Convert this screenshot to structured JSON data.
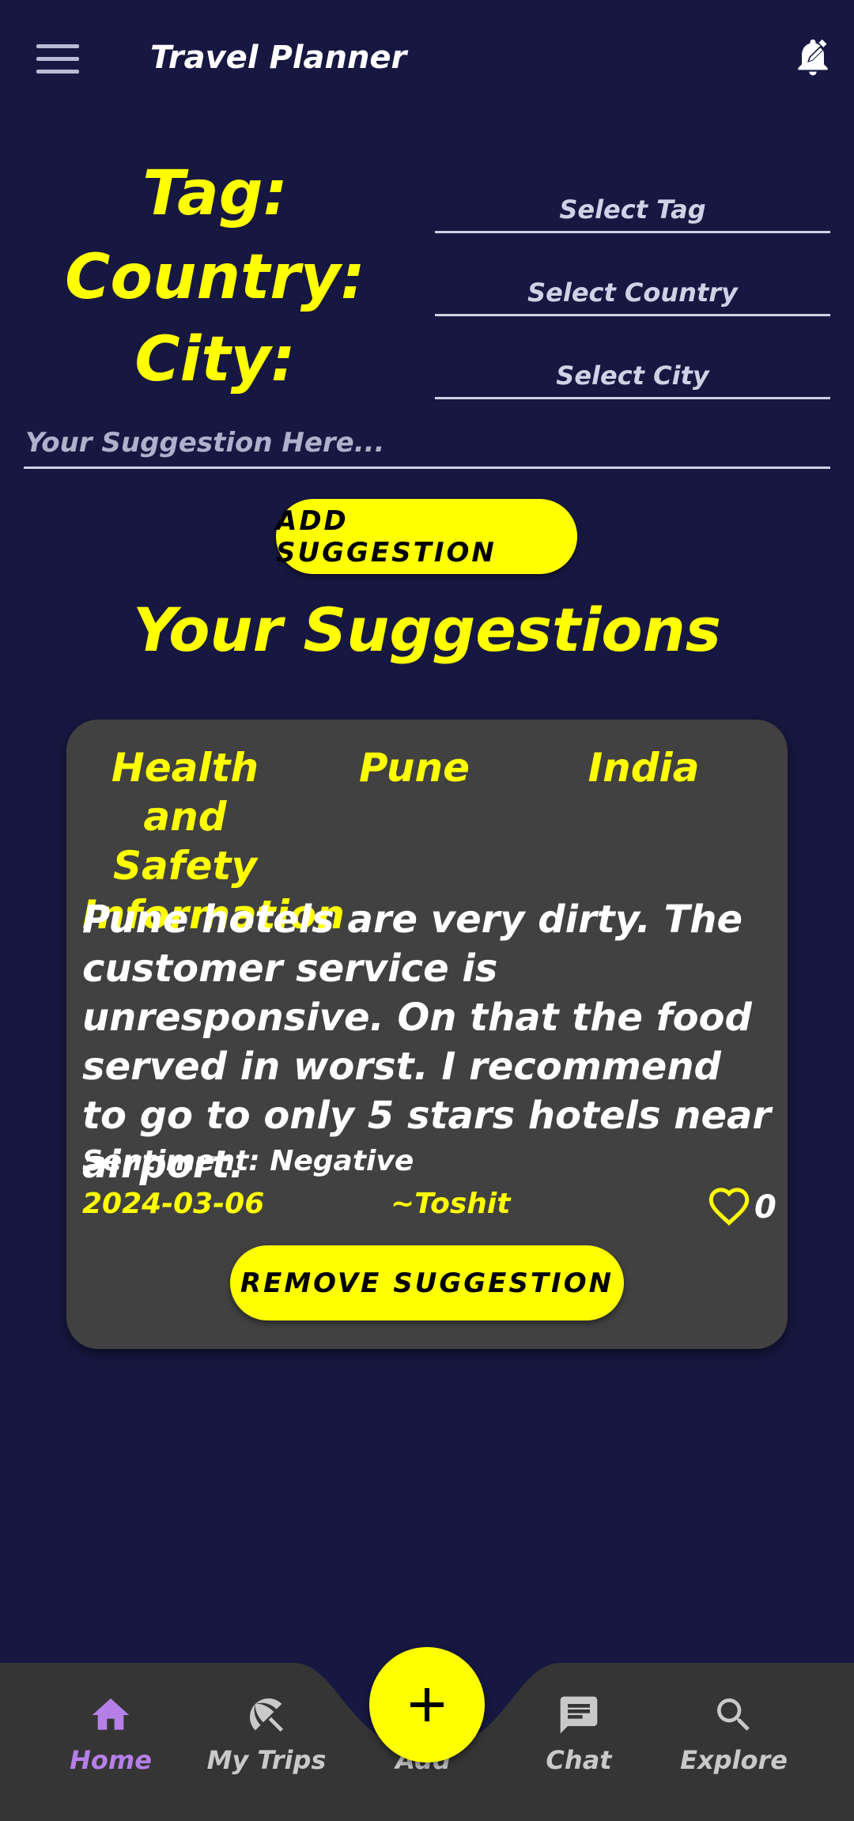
{
  "app": {
    "title": "Travel Planner"
  },
  "form": {
    "tag_label": "Tag:",
    "country_label": "Country:",
    "city_label": "City:",
    "tag_placeholder": "Select Tag",
    "country_placeholder": "Select Country",
    "city_placeholder": "Select City",
    "suggestion_placeholder": "Your Suggestion Here...",
    "add_button": "ADD SUGGESTION"
  },
  "section_title": "Your Suggestions",
  "suggestions": [
    {
      "tag": "Health and Safety Information",
      "city": "Pune",
      "country": "India",
      "text": "Pune hotels are very dirty. The customer service is unresponsive. On that the food served in worst. I recommend to go to only 5 stars hotels near airport.",
      "sentiment": "Sentiment: Negative",
      "date": "2024-03-06",
      "author": "~Toshit",
      "likes": "0",
      "remove_button": "REMOVE SUGGESTION"
    }
  ],
  "nav": {
    "items": [
      {
        "label": "Home",
        "icon": "home-icon",
        "active": true
      },
      {
        "label": "My Trips",
        "icon": "umbrella-icon"
      },
      {
        "label": "Add",
        "icon": "plus-icon"
      },
      {
        "label": "Chat",
        "icon": "chat-icon"
      },
      {
        "label": "Explore",
        "icon": "search-icon"
      }
    ]
  },
  "colors": {
    "background": "#171841",
    "accent": "#ffff00",
    "card": "#414141",
    "nav_active": "#b57fe8"
  }
}
